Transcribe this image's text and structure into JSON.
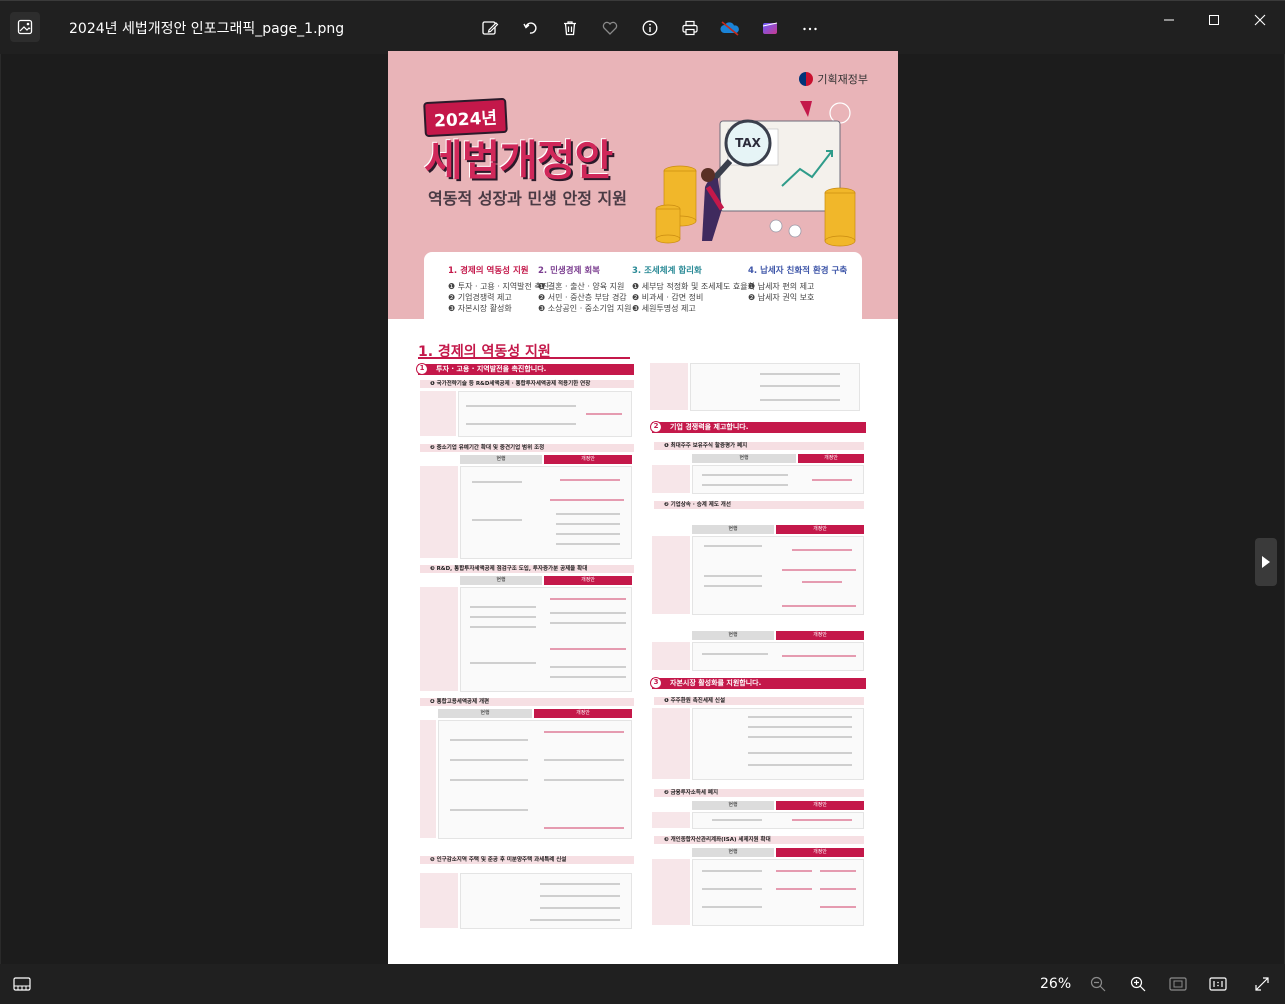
{
  "window": {
    "title": "2024년 세법개정안 인포그래픽_page_1.png",
    "toolbar": [
      "edit-image",
      "rotate",
      "delete",
      "favorite",
      "file-info",
      "print",
      "onedrive",
      "clipchamp",
      "more"
    ]
  },
  "status": {
    "zoom": "26%"
  },
  "document": {
    "ministry": "기획재정부",
    "year_badge": "2024년",
    "title": "세법개정안",
    "subtitle": "역동적 성장과 민생 안정 지원",
    "tax_sign": "TAX",
    "goals": [
      {
        "heading": "1. 경제의 역동성 지원",
        "items": [
          "❶ 투자 · 고용 · 지역발전 촉진",
          "❷ 기업경쟁력 제고",
          "❸ 자본시장 활성화"
        ]
      },
      {
        "heading": "2. 민생경제 회복",
        "items": [
          "❶ 결혼 · 출산 · 양육 지원",
          "❷ 서민 · 중산층 부담 경감",
          "❸ 소상공인 · 중소기업 지원"
        ]
      },
      {
        "heading": "3. 조세체계 합리화",
        "items": [
          "❶ 세부담 적정화 및 조세제도 효율화",
          "❷ 비과세 · 감면 정비",
          "❸ 세원투명성 제고"
        ]
      },
      {
        "heading": "4. 납세자 친화적 환경 구축",
        "items": [
          "❶ 납세자 편의 제고",
          "❷ 납세자 권익 보호"
        ]
      }
    ],
    "section1": {
      "title": "1. 경제의 역동성 지원",
      "heads": [
        {
          "num": "1",
          "text": "투자 · 고용 · 지역발전을 촉진합니다."
        },
        {
          "num": "2",
          "text": "기업 경쟁력을 제고합니다."
        },
        {
          "num": "3",
          "text": "자본시장 활성화를 지원합니다."
        }
      ],
      "subs_left": [
        "❶ 국가전략기술 등 R&D세액공제 · 통합투자세액공제 적용기한 연장",
        "❷ 중소기업 유예기간 확대 및 중견기업 범위 조정",
        "❸ R&D, 통합투자세액공제 점검구조 도입, 투자증가분 공제율 확대",
        "❹ 통합고용세액공제 개편",
        "❺ 인구감소지역 주택 및 준공 후 미분양주택 과세특례 신설"
      ],
      "subs_right": [
        "❶ 최대주주 보유주식 할증평가 폐지",
        "❷ 기업상속 · 승계 제도 개선",
        "❶ 주주환원 촉진세제 신설",
        "❷ 금융투자소득세 폐지",
        "❸ 개인종합자산관리계좌(ISA) 세제지원 확대"
      ],
      "col_current": "현행",
      "col_revised": "개정안"
    }
  },
  "colors": {
    "accent": "#c4184a",
    "hero_bg": "#e9b4b8",
    "chrome": "#202020"
  }
}
